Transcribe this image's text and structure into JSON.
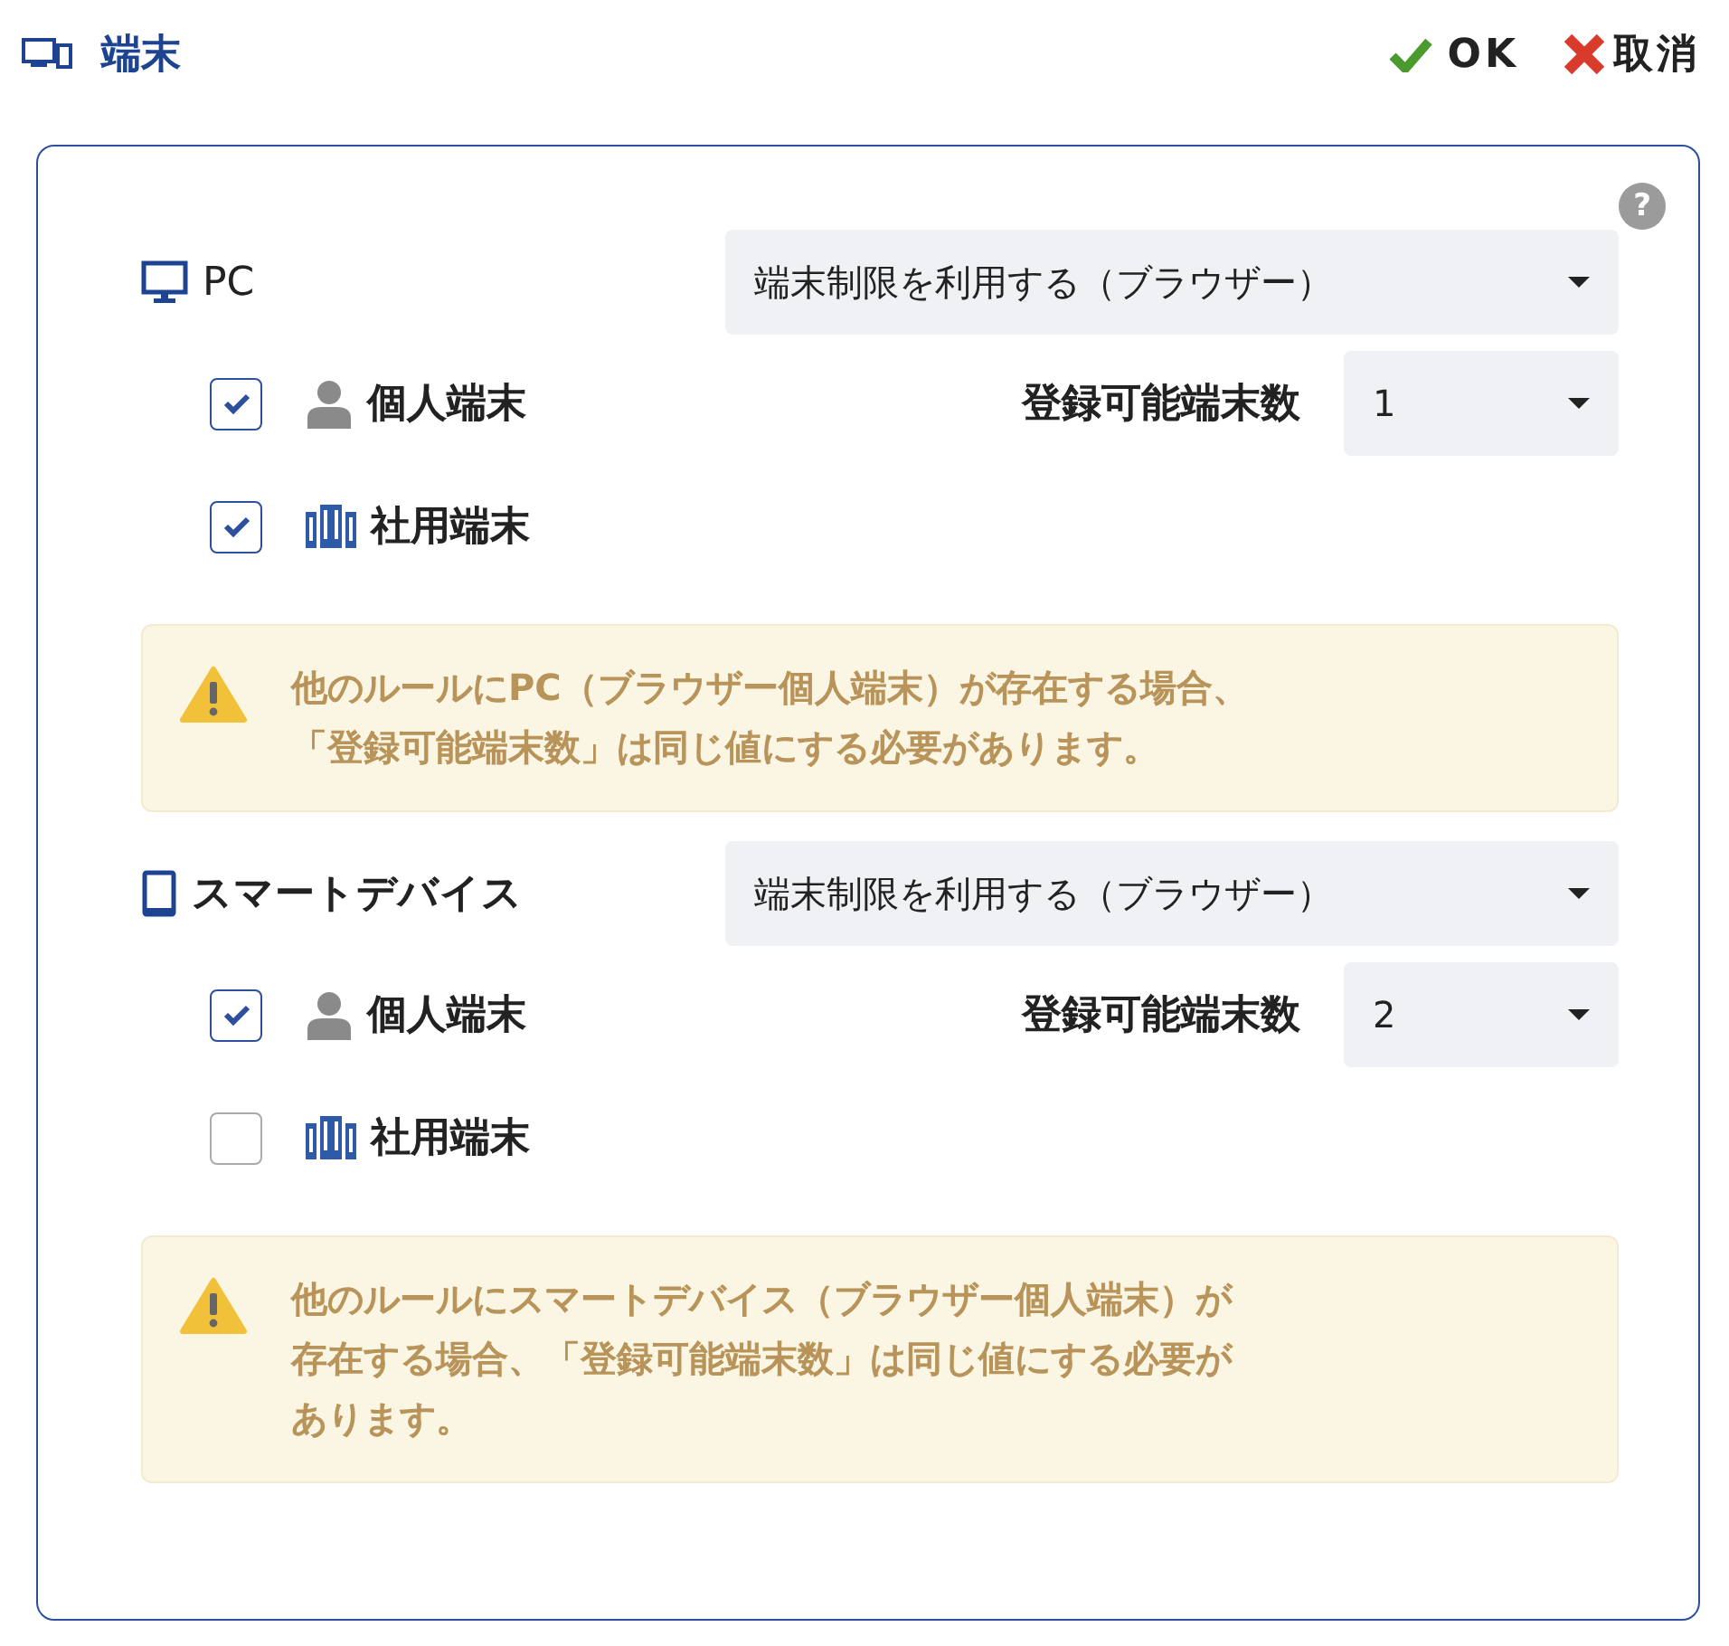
{
  "header": {
    "title": "端末",
    "ok": "OK",
    "cancel": "取消"
  },
  "help": "?",
  "sections": [
    {
      "kind": "pc",
      "label": "PC",
      "mode": "端末制限を利用する（ブラウザー）",
      "count_label": "登録可能端末数",
      "count": "1",
      "options": [
        {
          "kind": "personal",
          "label": "個人端末",
          "checked": true
        },
        {
          "kind": "corporate",
          "label": "社用端末",
          "checked": true
        }
      ],
      "warning": [
        "他のルールにPC（ブラウザー個人端末）が存在する場合、",
        "「登録可能端末数」は同じ値にする必要があります。"
      ]
    },
    {
      "kind": "smart",
      "label": "スマートデバイス",
      "mode": "端末制限を利用する（ブラウザー）",
      "count_label": "登録可能端末数",
      "count": "2",
      "options": [
        {
          "kind": "personal",
          "label": "個人端末",
          "checked": true
        },
        {
          "kind": "corporate",
          "label": "社用端末",
          "checked": false
        }
      ],
      "warning": [
        "他のルールにスマートデバイス（ブラウザー個人端末）が",
        "存在する場合、「登録可能端末数」は同じ値にする必要が",
        "あります。"
      ]
    }
  ]
}
